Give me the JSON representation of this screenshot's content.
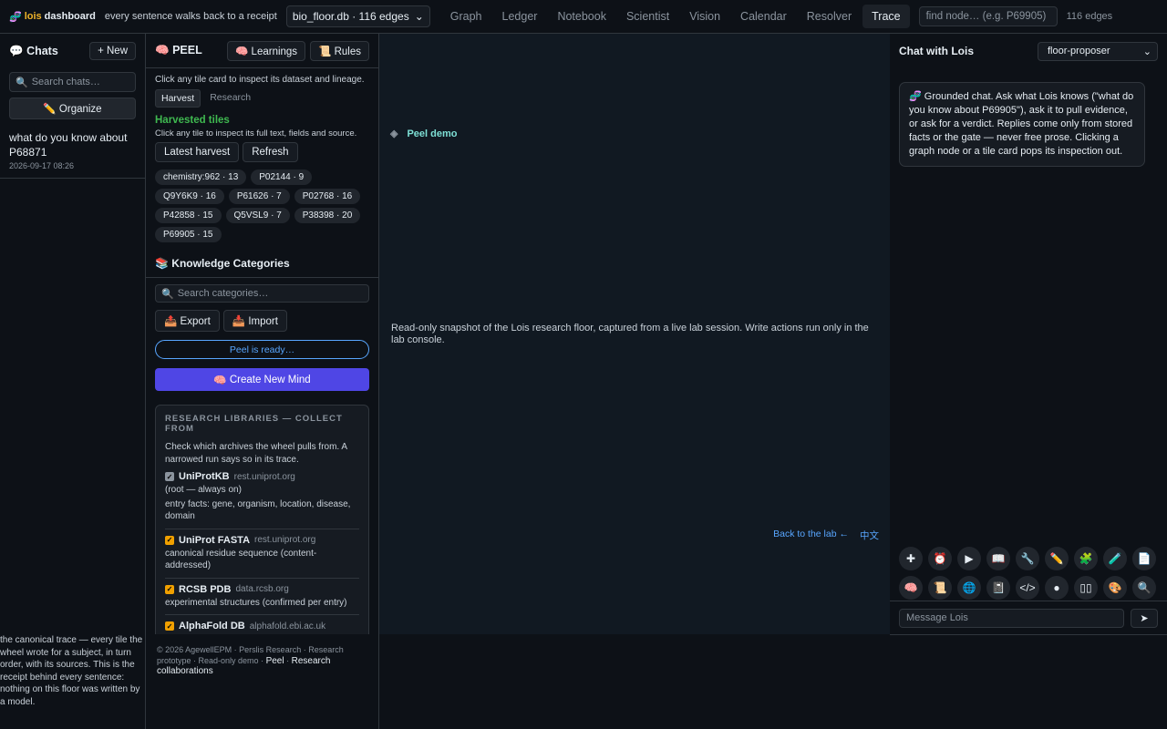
{
  "topbar": {
    "brand_prefix": "lois",
    "brand_suffix": "dashboard",
    "tagline": "every sentence walks back to a receipt",
    "db_select": "bio_floor.db · 116 edges",
    "tabs": [
      {
        "label": "Graph"
      },
      {
        "label": "Ledger"
      },
      {
        "label": "Notebook"
      },
      {
        "label": "Scientist"
      },
      {
        "label": "Vision"
      },
      {
        "label": "Calendar"
      },
      {
        "label": "Resolver"
      },
      {
        "label": "Trace",
        "active": true
      }
    ],
    "find_placeholder": "find node… (e.g. P69905)",
    "edges_count": "116 edges"
  },
  "chats": {
    "title": "Chats",
    "new_label": "+ New",
    "search_placeholder": "Search chats…",
    "organize_label": "✏️ Organize",
    "items": [
      {
        "question": "what do you know about P68871",
        "time": "2026-09-17 08:26"
      }
    ],
    "footer": "the canonical trace — every tile the wheel wrote for a subject, in turn order, with its sources. This is the receipt behind every sentence: nothing on this floor was written by a model."
  },
  "peel": {
    "title": "PEEL",
    "learnings_label": "Learnings",
    "rules_label": "Rules",
    "hint": "Click any tile card to inspect its dataset and lineage.",
    "subtabs": [
      {
        "label": "Harvest",
        "active": true
      },
      {
        "label": "Research"
      }
    ],
    "harvested_title": "Harvested tiles",
    "harvested_hint": "Click any tile to inspect its full text, fields and source.",
    "latest_harvest_label": "Latest harvest",
    "refresh_label": "Refresh",
    "chips": [
      "chemistry:962 · 13",
      "P02144 · 9",
      "Q9Y6K9 · 16",
      "P61626 · 7",
      "P02768 · 16",
      "P42858 · 15",
      "Q5VSL9 · 7",
      "P38398 · 20",
      "P69905 · 15"
    ],
    "kc_title": "Knowledge Categories",
    "search_cat_placeholder": "Search categories…",
    "export_label": "Export",
    "import_label": "Import",
    "ready_label": "Peel is ready…",
    "create_mind_label": "Create New Mind",
    "libraries": {
      "title": "RESEARCH LIBRARIES — COLLECT FROM",
      "desc": "Check which archives the wheel pulls from. A narrowed run says so in its trace.",
      "items": [
        {
          "name": "UniProtKB",
          "host": "rest.uniprot.org",
          "note": "(root — always on)",
          "desc": "entry facts: gene, organism, location, disease, domain",
          "disabled": true
        },
        {
          "name": "UniProt FASTA",
          "host": "rest.uniprot.org",
          "desc": "canonical residue sequence (content-addressed)"
        },
        {
          "name": "RCSB PDB",
          "host": "data.rcsb.org",
          "desc": "experimental structures (confirmed per entry)"
        },
        {
          "name": "AlphaFold DB",
          "host": "alphafold.ebi.ac.uk",
          "desc": "predicted structure"
        }
      ]
    }
  },
  "footer": {
    "copyright": "© 2026 AgewellEPM · Perslis Research · Research prototype · Read-only demo ·",
    "peel_link": "Peel",
    "research_link": "Research collaborations"
  },
  "canvas": {
    "demo_title": "Peel demo",
    "snapshot": "Read-only snapshot of the Lois research floor, captured from a live lab session. Write actions run only in the lab console.",
    "back_label": "Back to the lab ←",
    "lang_label": "中文"
  },
  "chatpanel": {
    "title": "Chat with Lois",
    "proposer": "floor-proposer",
    "bubble": "Grounded chat. Ask what Lois knows (\"what do you know about P69905\"), ask it to pull evidence, or ask for a verdict. Replies come only from stored facts or the gate — never free prose. Clicking a graph node or a tile card pops its inspection out.",
    "tools_row1": [
      {
        "glyph": "✚",
        "name": "add-icon"
      },
      {
        "glyph": "⏰",
        "name": "clock-icon"
      },
      {
        "glyph": "▶",
        "name": "play-icon"
      },
      {
        "glyph": "📖",
        "name": "book-icon"
      },
      {
        "glyph": "🔧",
        "name": "wrench-icon"
      },
      {
        "glyph": "✏️",
        "name": "pencil-icon"
      },
      {
        "glyph": "🧩",
        "name": "puzzle-icon"
      },
      {
        "glyph": "🧪",
        "name": "test-tube-icon"
      },
      {
        "glyph": "📄",
        "name": "document-icon"
      }
    ],
    "tools_row2": [
      {
        "glyph": "🧠",
        "name": "brain-icon"
      },
      {
        "glyph": "📜",
        "name": "scroll-icon"
      },
      {
        "glyph": "🌐",
        "name": "globe-icon"
      },
      {
        "glyph": "📓",
        "name": "notebook-icon"
      },
      {
        "glyph": "</>",
        "name": "code-icon"
      },
      {
        "glyph": "●",
        "name": "record-icon"
      },
      {
        "glyph": "▯▯",
        "name": "columns-icon"
      },
      {
        "glyph": "🎨",
        "name": "palette-icon"
      },
      {
        "glyph": "🔍",
        "name": "search-icon"
      }
    ],
    "message_placeholder": "Message Lois",
    "send_glyph": "➤"
  }
}
